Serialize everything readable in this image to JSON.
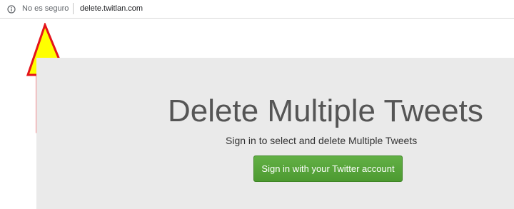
{
  "browser": {
    "security_label": "No es seguro",
    "url": "delete.twitlan.com",
    "info_icon": "info-circle-icon"
  },
  "annotation": {
    "arrow_icon": "up-arrow-icon",
    "arrow_fill": "#ffff00",
    "arrow_stroke": "#e4141b"
  },
  "hero": {
    "title": "Delete Multiple Tweets",
    "subtitle": "Sign in to select and delete Multiple Tweets",
    "button_label": "Sign in with your Twitter account",
    "button_color": "#57a53b",
    "background_color": "#eaeaea"
  }
}
